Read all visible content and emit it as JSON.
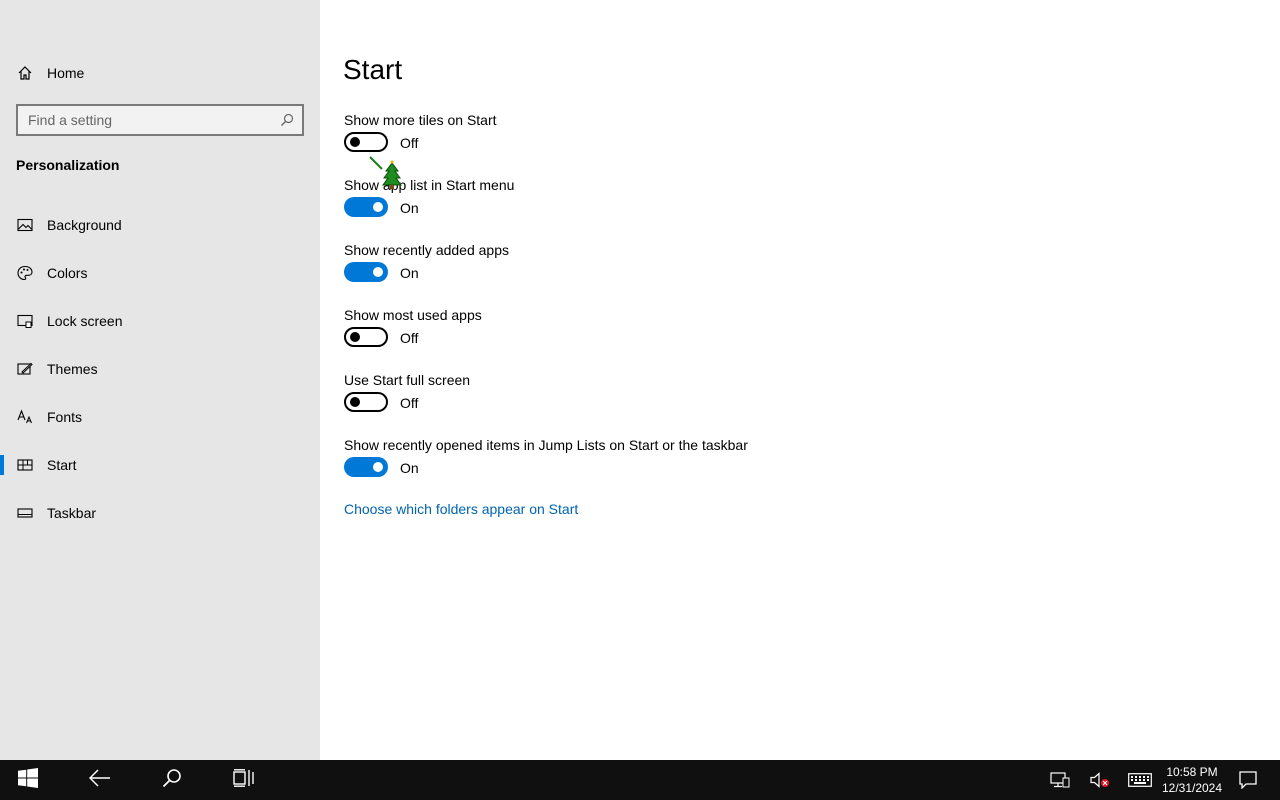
{
  "sidebar": {
    "home_label": "Home",
    "search_placeholder": "Find a setting",
    "section_title": "Personalization",
    "items": [
      {
        "label": "Background",
        "icon": "picture-icon"
      },
      {
        "label": "Colors",
        "icon": "palette-icon"
      },
      {
        "label": "Lock screen",
        "icon": "lock-screen-icon"
      },
      {
        "label": "Themes",
        "icon": "themes-icon"
      },
      {
        "label": "Fonts",
        "icon": "fonts-icon"
      },
      {
        "label": "Start",
        "icon": "start-tiles-icon",
        "selected": true
      },
      {
        "label": "Taskbar",
        "icon": "taskbar-icon"
      }
    ]
  },
  "main": {
    "title": "Start",
    "settings": [
      {
        "label": "Show more tiles on Start",
        "state": "Off",
        "on": false
      },
      {
        "label": "Show app list in Start menu",
        "state": "On",
        "on": true
      },
      {
        "label": "Show recently added apps",
        "state": "On",
        "on": true
      },
      {
        "label": "Show most used apps",
        "state": "Off",
        "on": false
      },
      {
        "label": "Use Start full screen",
        "state": "Off",
        "on": false
      },
      {
        "label": "Show recently opened items in Jump Lists on Start or the taskbar",
        "state": "On",
        "on": true
      }
    ],
    "link_text": "Choose which folders appear on Start"
  },
  "taskbar": {
    "time": "10:58 PM",
    "date": "12/31/2024"
  },
  "colors": {
    "accent": "#0078d7",
    "sidebar_bg": "#e6e6e6",
    "taskbar_bg": "#101010",
    "link": "#0063b1"
  }
}
